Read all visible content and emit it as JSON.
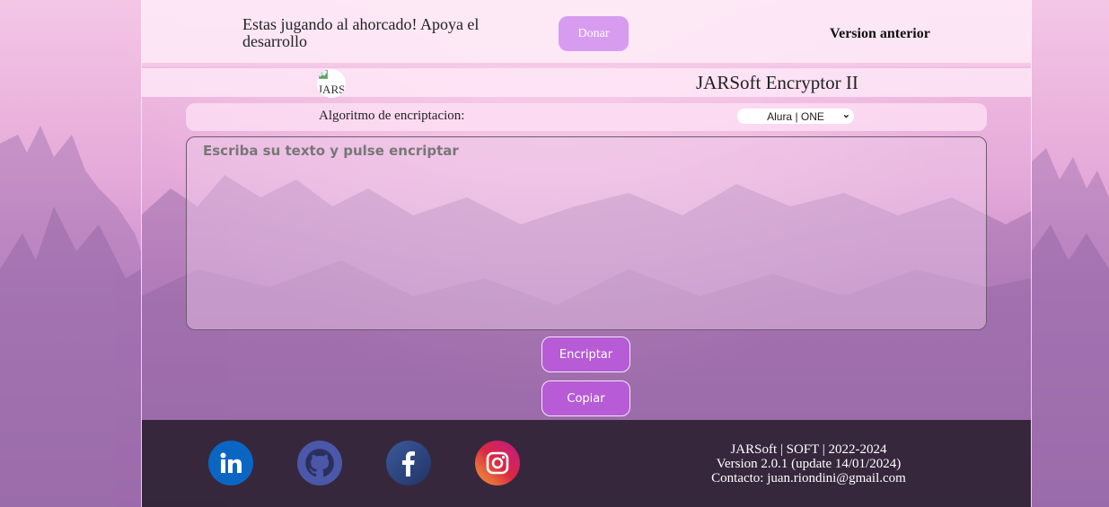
{
  "header": {
    "message": "Estas jugando al ahorcado! Apoya el desarrollo",
    "donate_label": "Donar",
    "previous_version_label": "Version anterior"
  },
  "title_bar": {
    "logo_alt": "JARS",
    "title": "JARSoft Encryptor II"
  },
  "algorithm": {
    "label": "Algoritmo de encriptacion:",
    "selected": "Alura | ONE"
  },
  "editor": {
    "placeholder": "Escriba su texto y pulse encriptar",
    "value": ""
  },
  "actions": {
    "encrypt_label": "Encriptar",
    "copy_label": "Copiar"
  },
  "footer": {
    "social": [
      {
        "icon": "linkedin-icon"
      },
      {
        "icon": "github-icon"
      },
      {
        "icon": "facebook-icon"
      },
      {
        "icon": "instagram-icon"
      }
    ],
    "line1": "JARSoft | SOFT | 2022-2024",
    "line2": "Version 2.0.1 (update 14/01/2024)",
    "line3": "Contacto: juan.riondini@gmail.com"
  },
  "colors": {
    "accent": "#b75bd6",
    "donate": "#d79cf0",
    "footer_bg": "#281e2d"
  }
}
